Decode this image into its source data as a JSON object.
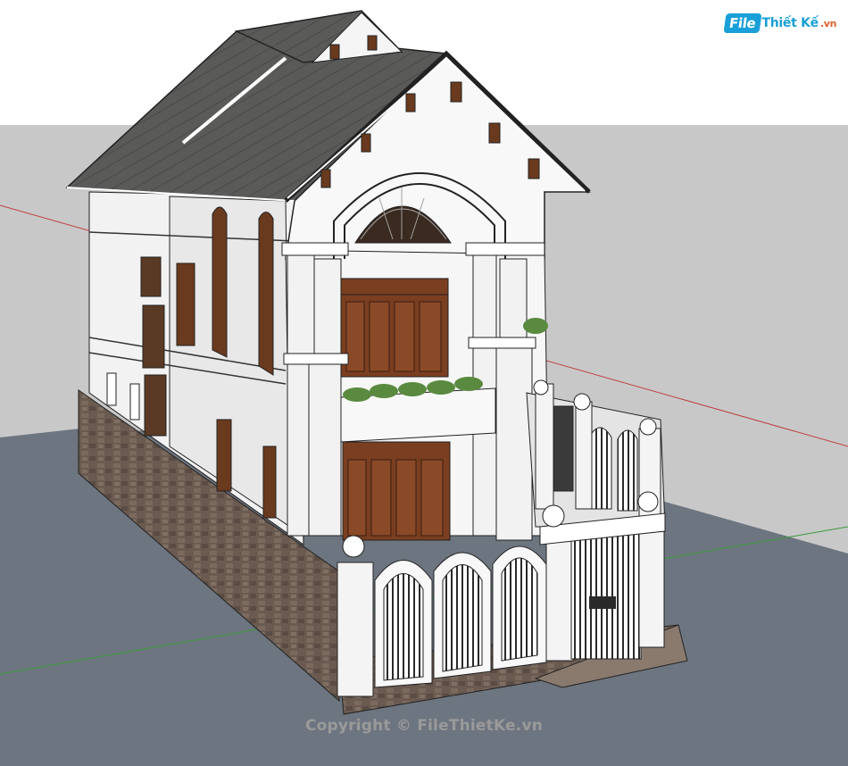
{
  "watermark": {
    "logo_part1": "File",
    "logo_part2": "Thiết Kế",
    "logo_part3": ".vn"
  },
  "copyright": "Copyright © FileThietKe.vn",
  "colors": {
    "sky": "#ffffff",
    "ground": "#c8c8c8",
    "asphalt": "#6d7580",
    "wall": "#f4f4f4",
    "roof": "#5a5a58",
    "stone": "#6a5a50",
    "wood": "#7a3e20",
    "plants": "#5a8a40",
    "accent_logo": "#1aa0d8"
  }
}
